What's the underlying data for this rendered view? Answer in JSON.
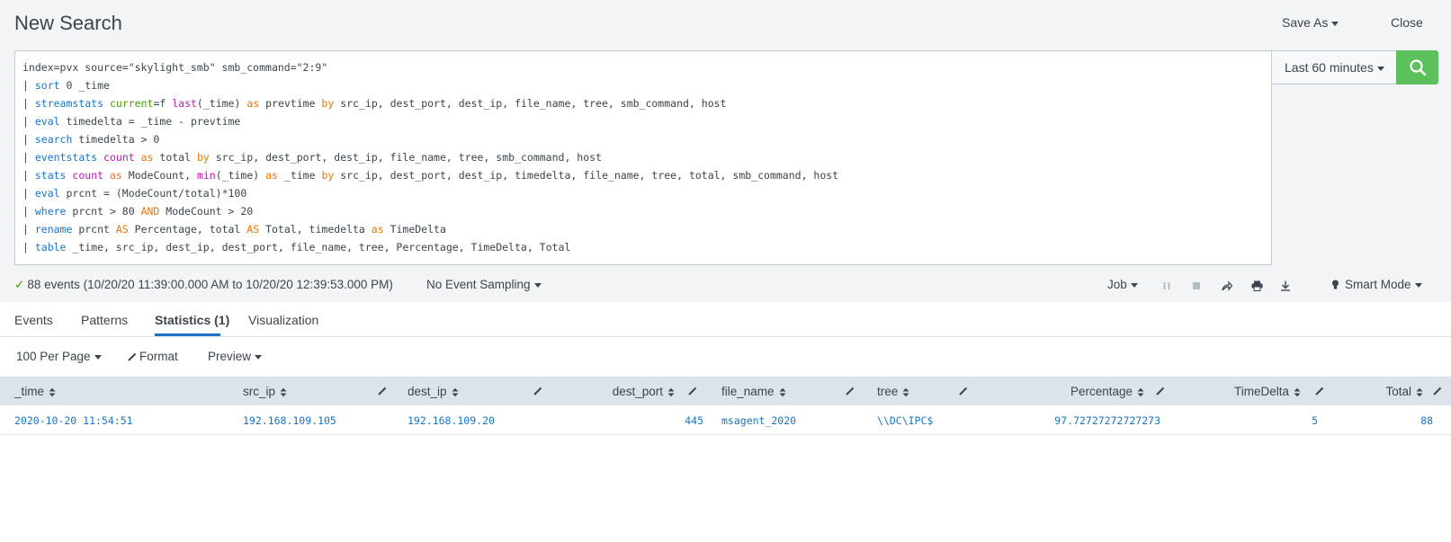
{
  "header": {
    "title": "New Search",
    "save_as": "Save As",
    "close": "Close"
  },
  "search": {
    "lines": [
      [
        {
          "t": "index=pvx source=\"skylight_smb\" smb_command=\"2:9\"",
          "c": ""
        }
      ],
      [
        {
          "t": "| ",
          "c": ""
        },
        {
          "t": "sort",
          "c": "kw"
        },
        {
          "t": " 0 _time",
          "c": ""
        }
      ],
      [
        {
          "t": "| ",
          "c": ""
        },
        {
          "t": "streamstats",
          "c": "kw"
        },
        {
          "t": " ",
          "c": ""
        },
        {
          "t": "current",
          "c": "arg"
        },
        {
          "t": "=f ",
          "c": ""
        },
        {
          "t": "last",
          "c": "fn"
        },
        {
          "t": "(_time) ",
          "c": ""
        },
        {
          "t": "as",
          "c": "op"
        },
        {
          "t": " prevtime ",
          "c": ""
        },
        {
          "t": "by",
          "c": "op"
        },
        {
          "t": " src_ip, dest_port, dest_ip, file_name, tree, smb_command, host",
          "c": ""
        }
      ],
      [
        {
          "t": "| ",
          "c": ""
        },
        {
          "t": "eval",
          "c": "kw"
        },
        {
          "t": " timedelta = _time - prevtime",
          "c": ""
        }
      ],
      [
        {
          "t": "| ",
          "c": ""
        },
        {
          "t": "search",
          "c": "kw"
        },
        {
          "t": " timedelta > 0",
          "c": ""
        }
      ],
      [
        {
          "t": "| ",
          "c": ""
        },
        {
          "t": "eventstats",
          "c": "kw"
        },
        {
          "t": " ",
          "c": ""
        },
        {
          "t": "count",
          "c": "fn"
        },
        {
          "t": " ",
          "c": ""
        },
        {
          "t": "as",
          "c": "op"
        },
        {
          "t": " total ",
          "c": ""
        },
        {
          "t": "by",
          "c": "op"
        },
        {
          "t": " src_ip, dest_port, dest_ip, file_name, tree, smb_command, host",
          "c": ""
        }
      ],
      [
        {
          "t": "| ",
          "c": ""
        },
        {
          "t": "stats",
          "c": "kw"
        },
        {
          "t": " ",
          "c": ""
        },
        {
          "t": "count",
          "c": "fn"
        },
        {
          "t": " ",
          "c": ""
        },
        {
          "t": "as",
          "c": "op"
        },
        {
          "t": " ModeCount, ",
          "c": ""
        },
        {
          "t": "min",
          "c": "fn"
        },
        {
          "t": "(_time) ",
          "c": ""
        },
        {
          "t": "as",
          "c": "op"
        },
        {
          "t": " _time ",
          "c": ""
        },
        {
          "t": "by",
          "c": "op"
        },
        {
          "t": " src_ip, dest_port, dest_ip, timedelta, file_name, tree, total, smb_command, host",
          "c": ""
        }
      ],
      [
        {
          "t": "| ",
          "c": ""
        },
        {
          "t": "eval",
          "c": "kw"
        },
        {
          "t": " prcnt = (ModeCount/total)*100",
          "c": ""
        }
      ],
      [
        {
          "t": "| ",
          "c": ""
        },
        {
          "t": "where",
          "c": "kw"
        },
        {
          "t": " prcnt > 80 ",
          "c": ""
        },
        {
          "t": "AND",
          "c": "op"
        },
        {
          "t": " ModeCount > 20",
          "c": ""
        }
      ],
      [
        {
          "t": "| ",
          "c": ""
        },
        {
          "t": "rename",
          "c": "kw"
        },
        {
          "t": " prcnt ",
          "c": ""
        },
        {
          "t": "AS",
          "c": "op"
        },
        {
          "t": " Percentage, total ",
          "c": ""
        },
        {
          "t": "AS",
          "c": "op"
        },
        {
          "t": " Total, timedelta ",
          "c": ""
        },
        {
          "t": "as",
          "c": "op"
        },
        {
          "t": " TimeDelta",
          "c": ""
        }
      ],
      [
        {
          "t": "| ",
          "c": ""
        },
        {
          "t": "table",
          "c": "kw"
        },
        {
          "t": " _time, src_ip, dest_ip, dest_port, file_name, tree, Percentage, TimeDelta, Total",
          "c": ""
        }
      ]
    ],
    "time_range": "Last 60 minutes"
  },
  "status": {
    "check": "✓",
    "events_text": "88 events (10/20/20 11:39:00.000 AM to 10/20/20 12:39:53.000 PM)",
    "sampling": "No Event Sampling",
    "job": "Job",
    "mode": "Smart Mode"
  },
  "tabs": [
    {
      "label": "Events"
    },
    {
      "label": "Patterns"
    },
    {
      "label": "Statistics (1)"
    },
    {
      "label": "Visualization"
    }
  ],
  "toolbar": {
    "per_page": "100 Per Page",
    "format": "Format",
    "preview": "Preview"
  },
  "table": {
    "columns": [
      "_time",
      "src_ip",
      "dest_ip",
      "dest_port",
      "file_name",
      "tree",
      "Percentage",
      "TimeDelta",
      "Total"
    ],
    "rows": [
      [
        "2020-10-20 11:54:51",
        "192.168.109.105",
        "192.168.109.20",
        "445",
        "msagent_2020",
        "\\\\DC\\IPC$",
        "97.72727272727273",
        "5",
        "88"
      ]
    ]
  },
  "colors": {
    "accent": "#1a73c8",
    "search_button": "#5cc05c",
    "table_header": "#dce3ea"
  }
}
